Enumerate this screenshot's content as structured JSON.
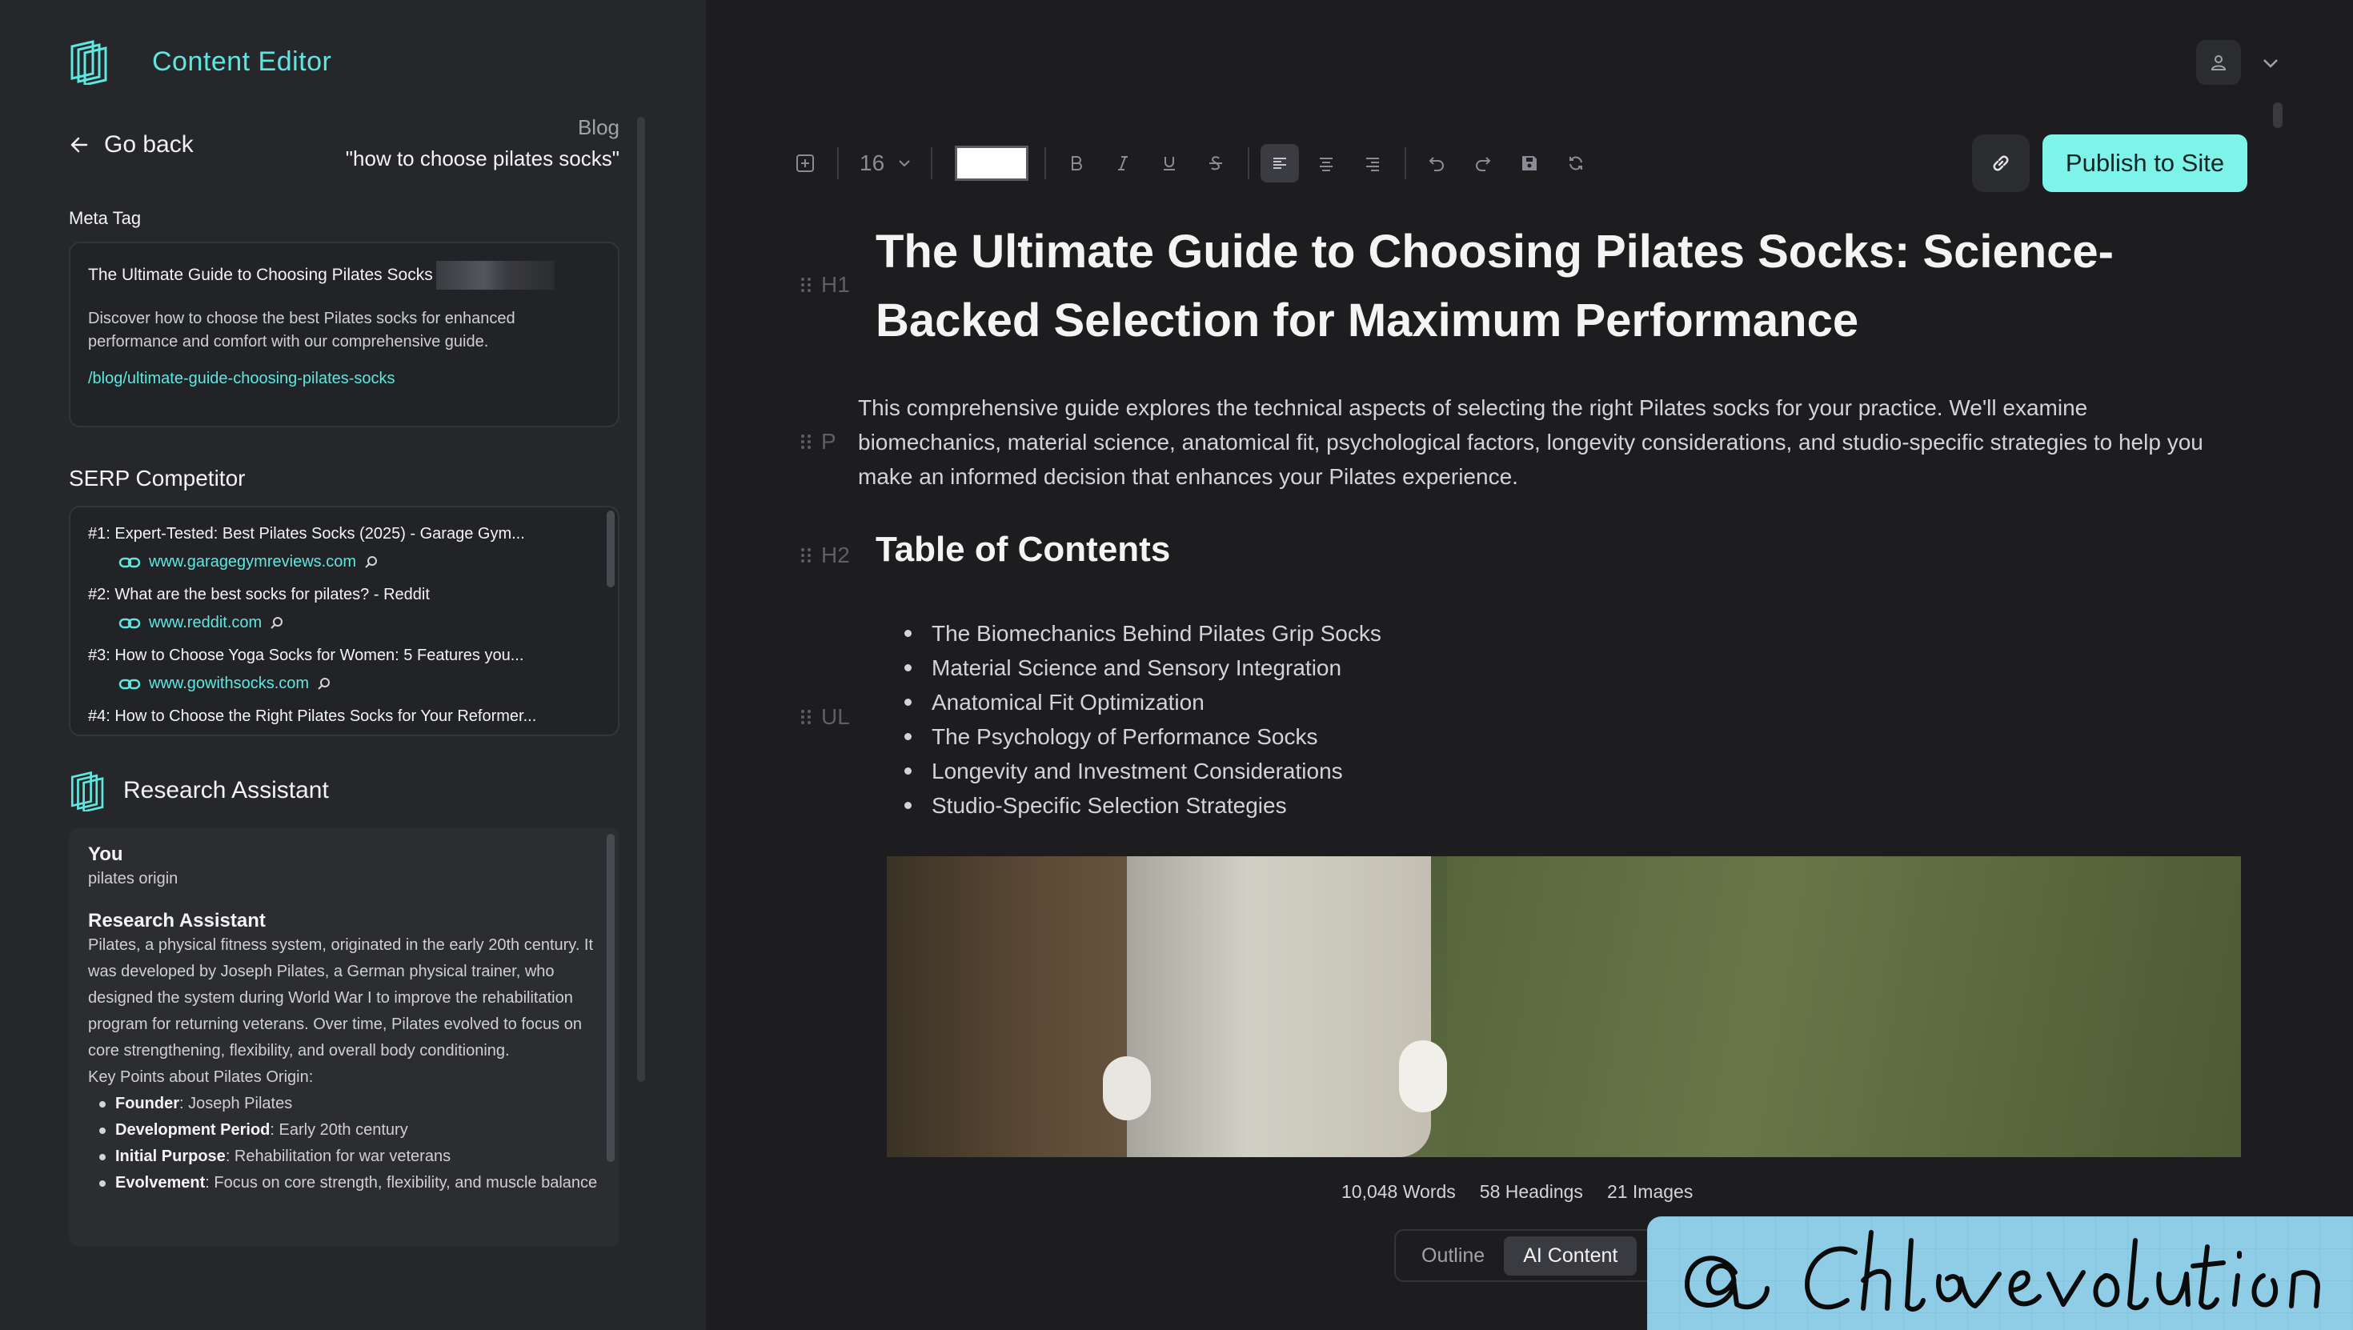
{
  "app": {
    "name": "Content Editor"
  },
  "nav": {
    "back_label": "Go back"
  },
  "breadcrumb": {
    "type": "Blog",
    "keyword": "\"how to choose pilates socks\""
  },
  "meta": {
    "section_label": "Meta Tag",
    "title": "The Ultimate Guide to Choosing Pilates Socks",
    "description": "Discover how to choose the best Pilates socks for enhanced performance and comfort with our comprehensive guide.",
    "slug": "/blog/ultimate-guide-choosing-pilates-socks"
  },
  "serp": {
    "title": "SERP Competitor",
    "items": [
      {
        "title": "#1: Expert-Tested: Best Pilates Socks (2025) - Garage Gym...",
        "url": "www.garagegymreviews.com"
      },
      {
        "title": "#2: What are the best socks for pilates? - Reddit",
        "url": "www.reddit.com"
      },
      {
        "title": "#3: How to Choose Yoga Socks for Women: 5 Features you...",
        "url": "www.gowithsocks.com"
      },
      {
        "title": "#4: How to Choose the Right Pilates Socks for Your Reformer...",
        "url": ""
      }
    ]
  },
  "research": {
    "title": "Research Assistant",
    "user_label": "You",
    "user_msg": "pilates origin",
    "assistant_label": "Research Assistant",
    "answer": "Pilates, a physical fitness system, originated in the early 20th century. It was developed by Joseph Pilates, a German physical trainer, who designed the system during World War I to improve the rehabilitation program for returning veterans. Over time, Pilates evolved to focus on core strengthening, flexibility, and overall body conditioning.",
    "key_points_label": "Key Points about Pilates Origin:",
    "points": [
      {
        "k": "Founder",
        "v": ": Joseph Pilates"
      },
      {
        "k": "Development Period",
        "v": ": Early 20th century"
      },
      {
        "k": "Initial Purpose",
        "v": ": Rehabilitation for war veterans"
      },
      {
        "k": "Evolvement",
        "v": ": Focus on core strength, flexibility, and muscle balance"
      }
    ]
  },
  "toolbar": {
    "font_size": "16",
    "text_color": "#ffffff"
  },
  "actions": {
    "publish_label": "Publish to Site"
  },
  "blocks": {
    "h1_tag": "H1",
    "p_tag": "P",
    "h2_tag": "H2",
    "ul_tag": "UL"
  },
  "document": {
    "h1": "The Ultimate Guide to Choosing Pilates Socks: Science-Backed Selection for Maximum Performance",
    "intro": "This comprehensive guide explores the technical aspects of selecting the right Pilates socks for your practice. We'll examine biomechanics, material science, anatomical fit, psychological factors, longevity considerations, and studio-specific strategies to help you make an informed decision that enhances your Pilates experience.",
    "h2": "Table of Contents",
    "toc": [
      "The Biomechanics Behind Pilates Grip Socks",
      "Material Science and Sensory Integration",
      "Anatomical Fit Optimization",
      "The Psychology of Performance Socks",
      "Longevity and Investment Considerations",
      "Studio-Specific Selection Strategies"
    ]
  },
  "stats": {
    "words": "10,048 Words",
    "headings": "58 Headings",
    "images": "21 Images"
  },
  "view_tabs": {
    "outline": "Outline",
    "ai_content": "AI Content"
  },
  "colors": {
    "accent": "#5ee7df",
    "publish_bg": "#7df3ea",
    "sidebar_bg": "#26272b",
    "main_bg": "#1d1d20"
  }
}
